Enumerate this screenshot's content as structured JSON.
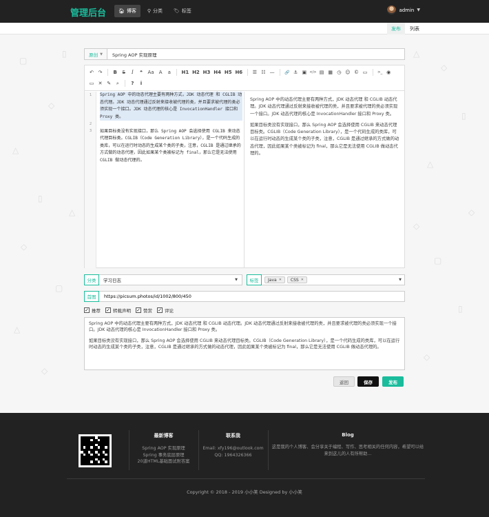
{
  "navbar": {
    "brand": "管理后台",
    "items": [
      {
        "label": "博客",
        "icon": "home-icon",
        "active": true
      },
      {
        "label": "分类",
        "icon": "location-icon",
        "active": false
      },
      {
        "label": "标签",
        "icon": "tag-icon",
        "active": false
      }
    ],
    "user": {
      "name": "admin"
    }
  },
  "subnav": {
    "publish": "发布",
    "list": "列表"
  },
  "editor_form": {
    "type_dropdown": "原创",
    "title_value": "Spring AOP 实现原理",
    "line_numbers": [
      "1",
      "2",
      "3"
    ],
    "markdown_lines": [
      "Spring AOP 中的动态代理主要有两种方式，JDK 动态代理 和 CGLIB 动态代理。JDK 动态代理通过反射来接收被代理的类，并且要求被代理的类必须实现一个接口。JDK 动态代理的核心是 InvocationHandler 接口和 Proxy 类。",
      "",
      "如果目标类没有实现接口，那么 Spring AOP 会选择使用 CGLIB 来动态代理目标类。CGLIB（Code Generation Library），是一个代码生成的类库，可以在运行时动态的生成某个类的子类，注意，CGLIB 是通过继承的方式做的动态代理，因此如果某个类被标记为 final，那么它是无法使用 CGLIB 做动态代理的。"
    ],
    "preview_paragraphs": [
      "Spring AOP 中的动态代理主要有两种方式，JDK 动态代理 和 CGLIB 动态代理。JDK 动态代理通过反射来接收被代理的类，并且要求被代理的类必须实现一个接口。JDK 动态代理的核心是 InvocationHandler 接口和 Proxy 类。",
      "如果目标类没有实现接口，那么 Spring AOP 会选择使用 CGLIB 来动态代理目标类。CGLIB（Code Generation Library），是一个代码生成的类库，可以在运行时动态的生成某个类的子类，注意，CGLIB 是通过继承的方式做的动态代理，因此如果某个类被标记为 final，那么它是无法使用 CGLIB 做动态代理的。"
    ],
    "toolbar_icons": [
      "undo-icon",
      "redo-icon",
      "bold-icon",
      "strikethrough-icon",
      "italic-icon",
      "quote-icon",
      "uppercase-icon",
      "capitalize-icon",
      "lowercase-icon",
      "h1-icon",
      "h2-icon",
      "h3-icon",
      "h4-icon",
      "h5-icon",
      "h6-icon",
      "unordered-list-icon",
      "ordered-list-icon",
      "hr-icon",
      "link-icon",
      "anchor-icon",
      "image-icon",
      "code-icon",
      "code-block-icon",
      "table-icon",
      "datetime-icon",
      "emoji-icon",
      "html-entities-icon",
      "pagebreak-icon",
      "watch-icon",
      "preview-icon",
      "fullscreen-icon",
      "clear-icon",
      "search-icon",
      "help-icon",
      "info-icon"
    ],
    "toolbar_glyphs": {
      "undo": "↶",
      "redo": "↷",
      "bold": "B",
      "strike": "S",
      "italic": "I",
      "quote": "❝",
      "upper": "Aa",
      "cap": "A",
      "lower": "a",
      "h1": "H1",
      "h2": "H2",
      "h3": "H3",
      "h4": "H4",
      "h5": "H5",
      "h6": "H6",
      "ul": "☰",
      "ol": "☷",
      "hr": "—",
      "link": "🔗",
      "anchor": "⚓",
      "image": "▣",
      "code": "</>",
      "codeblock": "▤",
      "table": "▦",
      "datetime": "◷",
      "emoji": "☺",
      "entities": "©",
      "pagebreak": "▭",
      "terminal": ">_",
      "watch": "◉",
      "preview": "▭",
      "fullscreen": "✕",
      "clear": "✎",
      "search": "⌕",
      "help": "?",
      "info": "i"
    },
    "category_label": "分类",
    "category_value": "学习日志",
    "tags_label": "标签",
    "tags": [
      "Java",
      "CSS"
    ],
    "cover_label": "首图",
    "cover_value": "https://picsum.photos/id/1002/800/450",
    "checkboxes": [
      {
        "label": "推荐",
        "checked": true
      },
      {
        "label": "转载声明",
        "checked": true
      },
      {
        "label": "赞赏",
        "checked": true
      },
      {
        "label": "评论",
        "checked": true
      }
    ],
    "summary_paragraphs": [
      "Spring AOP 中的动态代理主要有两种方式，JDK 动态代理 和 CGLIB 动态代理。JDK 动态代理通过反射来接收被代理的类，并且要求被代理的类必须实现一个接口。JDK 动态代理的核心是 InvocationHandler 接口和 Proxy 类。",
      "如果目标类没有实现接口，那么 Spring AOP 会选择使用 CGLIB 来动态代理目标类。CGLIB（Code Generation Library），是一个代码生成的类库，可以在运行时动态的生成某个类的子类，注意，CGLIB 是通过继承的方式做的动态代理，因此如果某个类被标记为 final，那么它是无法使用 CGLIB 做动态代理的。"
    ],
    "buttons": {
      "back": "返回",
      "save": "保存",
      "publish": "发布"
    }
  },
  "footer": {
    "latest_title": "最新博客",
    "latest_items": [
      "Spring AOP 实现原理",
      "Spring 事务底层原理",
      "20道HTML基础面试附答案"
    ],
    "contact_title": "联系我",
    "email_label": "Email:",
    "email": "xfy196@outlook.com",
    "qq_label": "QQ:",
    "qq": "1964326366",
    "blog_title": "Blog",
    "blog_desc": "这是我的个人博客、会分享关于编程、写作、思考相关的任何内容，希望可以给来到这儿的人有所帮助...",
    "copyright": "Copyright © 2018 - 2019 小小笑 Designed by 小小笑"
  },
  "colors": {
    "accent": "#1abc9c",
    "navbar_bg": "#222222",
    "footer_bg": "#222222",
    "save_button_bg": "#111111"
  }
}
